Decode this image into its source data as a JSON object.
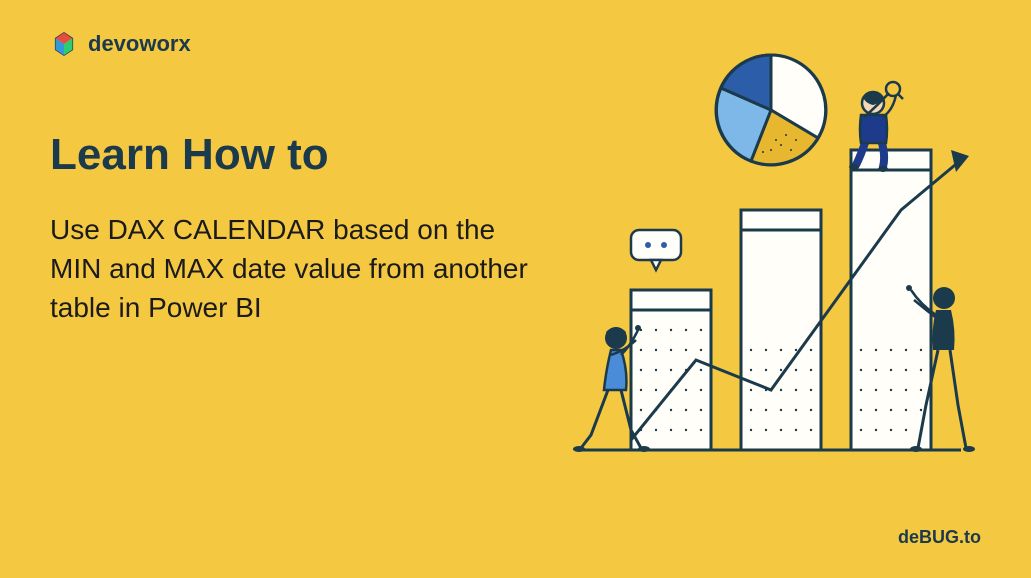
{
  "logo": {
    "text": "devoworx"
  },
  "heading": "Learn How to",
  "subheading": "Use DAX CALENDAR based on the MIN and MAX date value from another table in Power BI",
  "footer_brand": "deBUG.to"
}
